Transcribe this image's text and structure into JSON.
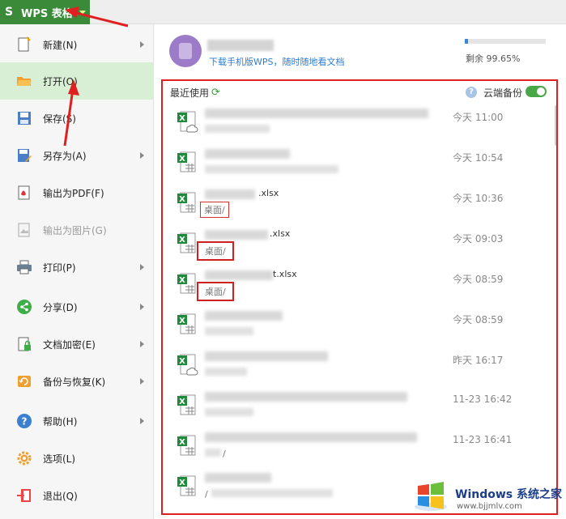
{
  "app": {
    "title": "WPS 表格",
    "accent": "#3a8a3a"
  },
  "menu": {
    "items": [
      {
        "label": "新建(N)",
        "icon": "new-file-icon",
        "submenu": true
      },
      {
        "label": "打开(O)",
        "icon": "open-folder-icon",
        "submenu": false,
        "active": true
      },
      {
        "label": "保存(S)",
        "icon": "save-icon",
        "submenu": false
      },
      {
        "label": "另存为(A)",
        "icon": "save-as-icon",
        "submenu": true
      },
      {
        "label": "输出为PDF(F)",
        "icon": "pdf-icon",
        "submenu": false
      },
      {
        "label": "输出为图片(G)",
        "icon": "image-export-icon",
        "submenu": false,
        "disabled": true
      },
      {
        "label": "打印(P)",
        "icon": "print-icon",
        "submenu": true
      },
      {
        "label": "分享(D)",
        "icon": "share-icon",
        "submenu": true
      },
      {
        "label": "文档加密(E)",
        "icon": "lock-icon",
        "submenu": true
      },
      {
        "label": "备份与恢复(K)",
        "icon": "backup-icon",
        "submenu": true
      },
      {
        "label": "帮助(H)",
        "icon": "help-icon",
        "submenu": true
      },
      {
        "label": "选项(L)",
        "icon": "gear-icon",
        "submenu": false
      },
      {
        "label": "退出(Q)",
        "icon": "exit-icon",
        "submenu": false
      }
    ]
  },
  "account": {
    "download_link": "下载手机版WPS，随时随地看文档",
    "quota_text": "剩余 99.65%",
    "quota_used_fraction": 0.0035
  },
  "recent": {
    "header": "最近使用",
    "cloud_backup_label": "云端备份",
    "cloud_backup_on": true,
    "files": [
      {
        "name_visible": "",
        "path": "",
        "time": "今天 11:00",
        "icon": "excel-cloud-file-icon"
      },
      {
        "name_visible": "",
        "path": "",
        "time": "今天 10:54",
        "icon": "excel-file-icon"
      },
      {
        "name_visible": ".xlsx",
        "path": "桌面/",
        "time": "今天 10:36",
        "icon": "excel-file-icon"
      },
      {
        "name_visible": ".xlsx",
        "path": "桌面/",
        "time": "今天 09:03",
        "icon": "excel-file-icon"
      },
      {
        "name_visible": "t.xlsx",
        "path": "桌面/",
        "time": "今天 08:59",
        "icon": "excel-file-icon"
      },
      {
        "name_visible": "",
        "path": "",
        "time": "今天 08:59",
        "icon": "excel-file-icon"
      },
      {
        "name_visible": "",
        "path": "",
        "time": "昨天 16:17",
        "icon": "excel-cloud-file-icon"
      },
      {
        "name_visible": "",
        "path": "",
        "time": "11-23 16:42",
        "icon": "excel-file-icon"
      },
      {
        "name_visible": "",
        "path": "/",
        "time": "11-23 16:41",
        "icon": "excel-file-icon"
      },
      {
        "name_visible": "",
        "path": "/",
        "time": "",
        "icon": "excel-file-icon"
      }
    ]
  },
  "watermark": {
    "title": "Windows 系统之家",
    "url": "www.bjjmlv.com"
  }
}
